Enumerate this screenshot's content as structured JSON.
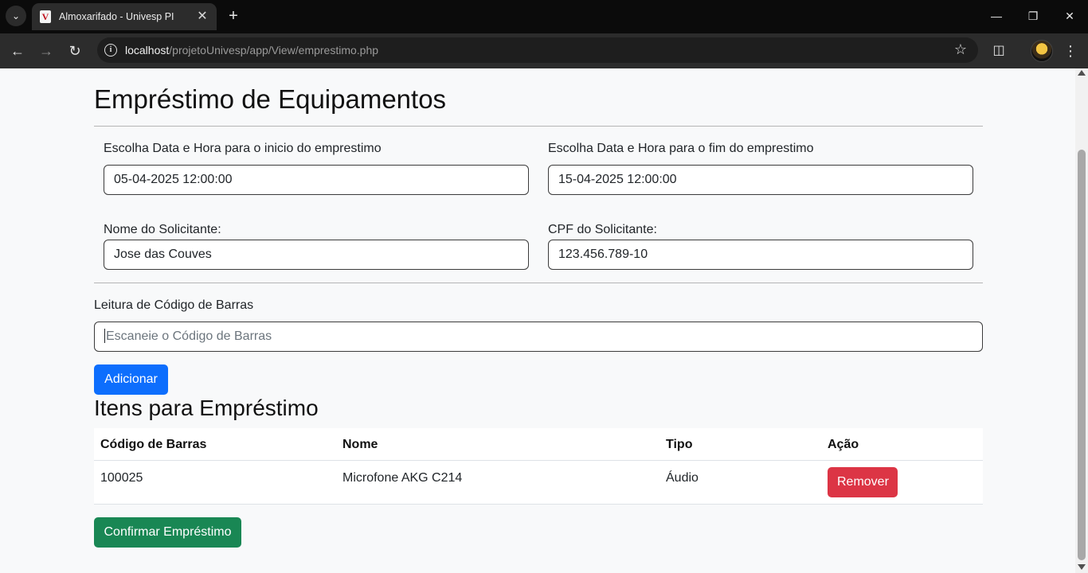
{
  "browser": {
    "tab_title": "Almoxarifado - Univesp PI",
    "favicon_letter": "V",
    "url_host": "localhost",
    "url_path": "/projetoUnivesp/app/View/emprestimo.php"
  },
  "page": {
    "title": "Empréstimo de Equipamentos",
    "form": {
      "start_label": "Escolha Data e Hora para o inicio do emprestimo",
      "start_value": "05-04-2025 12:00:00",
      "end_label": "Escolha Data e Hora para o fim do emprestimo",
      "end_value": "15-04-2025 12:00:00",
      "name_label": "Nome do Solicitante:",
      "name_value": "Jose das Couves",
      "cpf_label": "CPF do Solicitante:",
      "cpf_value": "123.456.789-10"
    },
    "barcode": {
      "label": "Leitura de Código de Barras",
      "placeholder": "Escaneie o Código de Barras",
      "add_button": "Adicionar"
    },
    "items": {
      "title": "Itens para Empréstimo",
      "columns": [
        "Código de Barras",
        "Nome",
        "Tipo",
        "Ação"
      ],
      "rows": [
        {
          "code": "100025",
          "name": "Microfone AKG C214",
          "type": "Áudio",
          "action": "Remover"
        }
      ]
    },
    "confirm_button": "Confirmar Empréstimo"
  },
  "colors": {
    "primary": "#0d6efd",
    "danger": "#dc3545",
    "success": "#198754"
  }
}
